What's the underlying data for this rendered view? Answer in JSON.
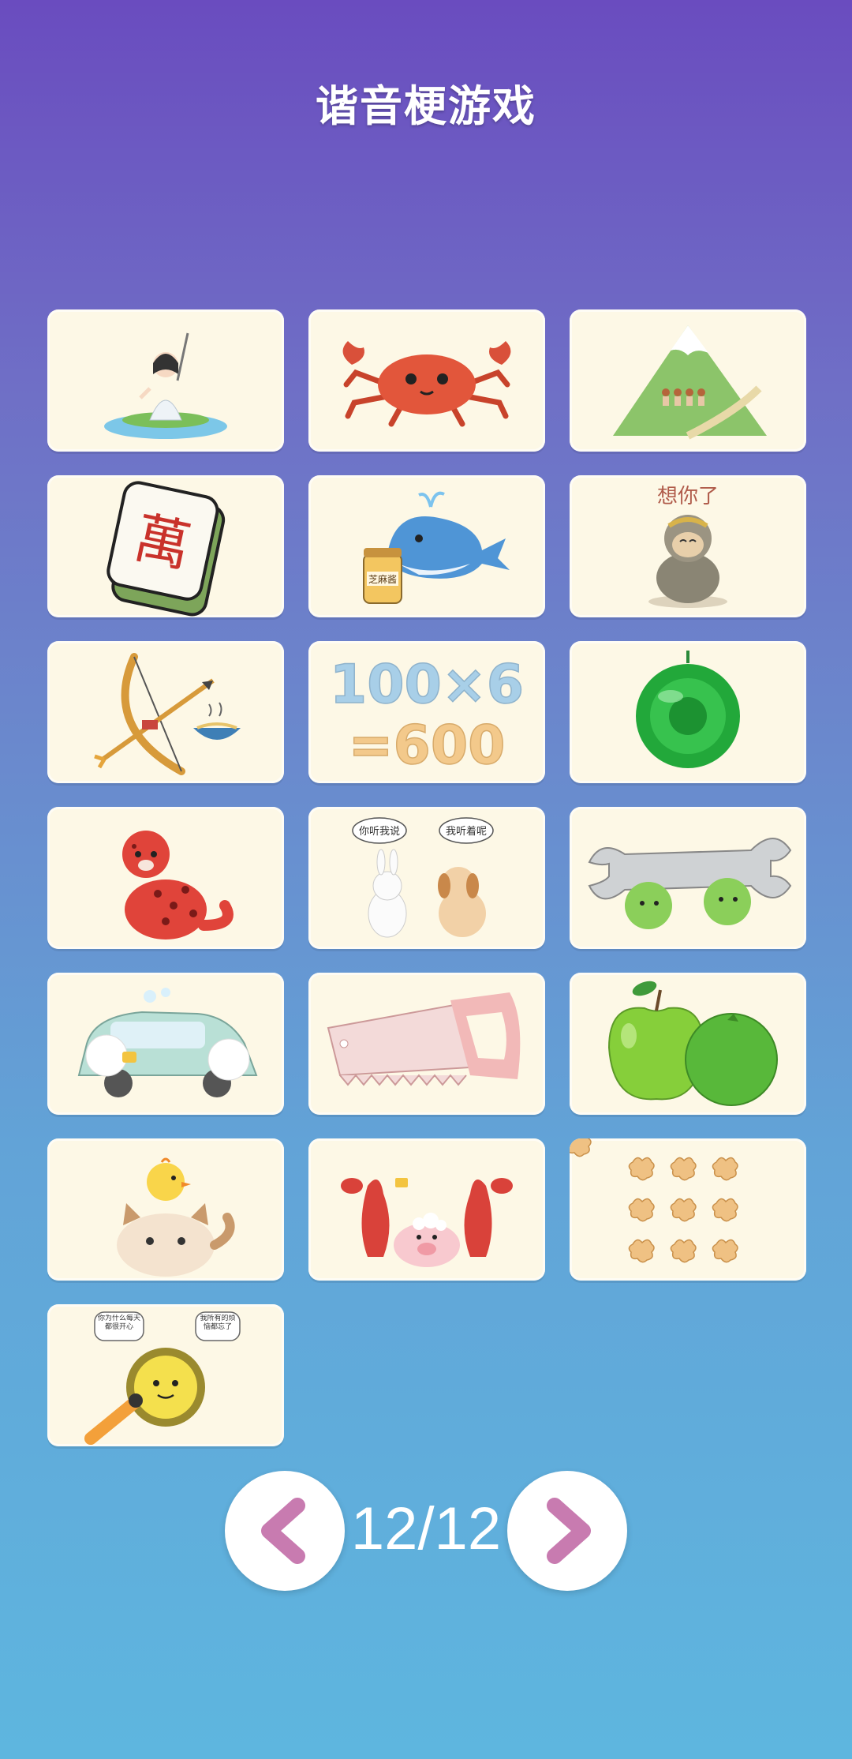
{
  "header": {
    "title": "谐音梗游戏"
  },
  "cards": [
    {
      "name": "swordswoman-card",
      "icon": "swordswoman-by-lake-icon"
    },
    {
      "name": "crab-card",
      "icon": "crab-icon"
    },
    {
      "name": "mountain-card",
      "icon": "mountain-with-people-icon"
    },
    {
      "name": "mahjong-card",
      "icon": "mahjong-tile-icon",
      "text": "萬"
    },
    {
      "name": "whale-card",
      "icon": "whale-with-sesame-jar-icon",
      "text": "芝麻酱"
    },
    {
      "name": "monkey-card",
      "icon": "monkey-statue-icon",
      "text": "想你了"
    },
    {
      "name": "bow-noodles-card",
      "icon": "bow-arrow-noodles-icon"
    },
    {
      "name": "math-card",
      "icon": "math-equation-icon",
      "text_line1": "100×6",
      "text_line2": "=600"
    },
    {
      "name": "gong-card",
      "icon": "green-gong-icon"
    },
    {
      "name": "leopard-card",
      "icon": "red-leopard-icon"
    },
    {
      "name": "rabbit-dog-card",
      "icon": "rabbit-and-dog-icon",
      "bubble_left": "你听我说",
      "bubble_right": "我听着呢"
    },
    {
      "name": "wrench-card",
      "icon": "wrench-with-moss-balls-icon"
    },
    {
      "name": "sheep-car-card",
      "icon": "sheep-washing-car-icon"
    },
    {
      "name": "saw-card",
      "icon": "saw-icon"
    },
    {
      "name": "apple-card",
      "icon": "green-apple-and-orange-icon"
    },
    {
      "name": "chick-cat-card",
      "icon": "chick-on-cat-icon"
    },
    {
      "name": "lobster-pig-card",
      "icon": "lobsters-washing-pig-icon"
    },
    {
      "name": "ginger-card",
      "icon": "nine-ginger-icon"
    },
    {
      "name": "durian-card",
      "icon": "durian-interview-icon",
      "bubble_left": "你为什么每天都很开心",
      "bubble_right": "我所有的烦恼都忘了"
    }
  ],
  "pager": {
    "current": "12/12"
  },
  "colors": {
    "accent": "#c87bb0",
    "page_text": "#ffffff"
  }
}
